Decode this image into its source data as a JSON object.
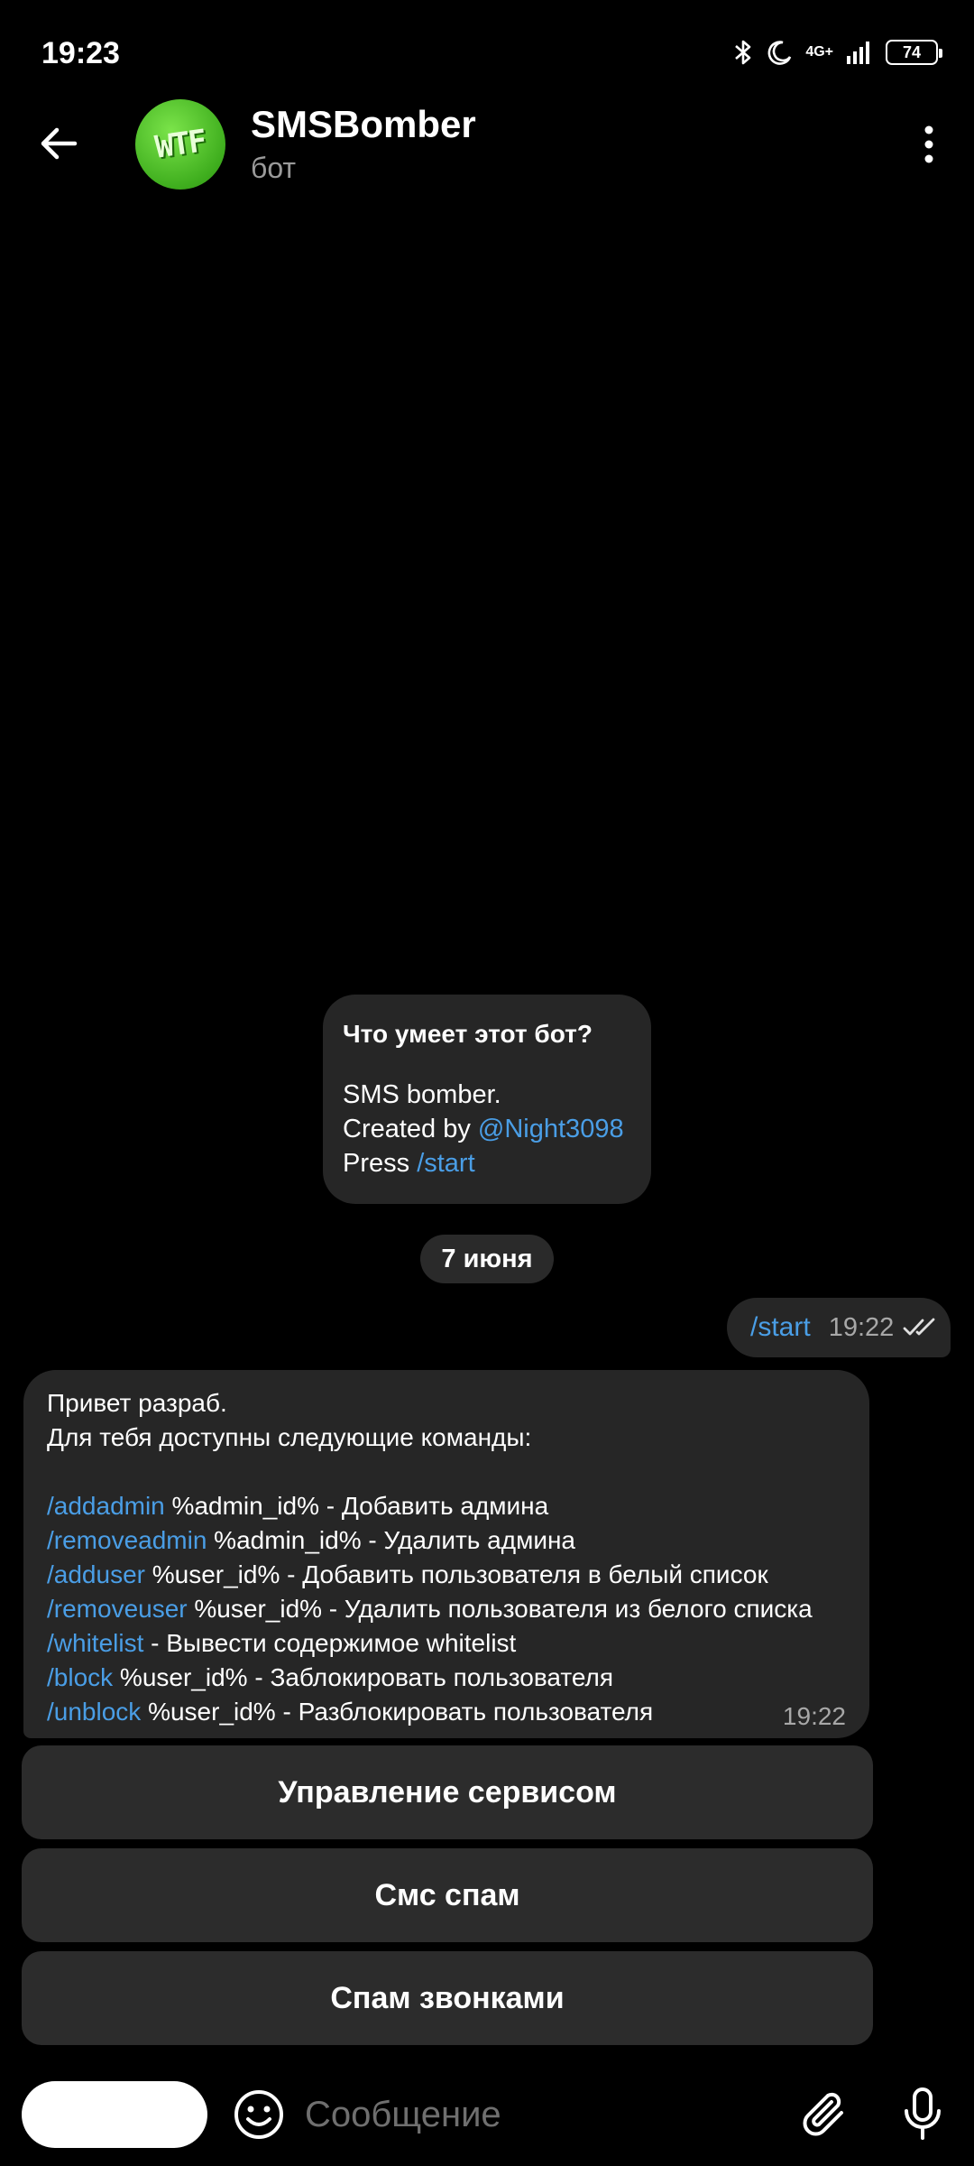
{
  "status_bar": {
    "time": "19:23",
    "network": "4G+",
    "battery": "74",
    "icons": [
      "bluetooth-icon",
      "moon-icon",
      "signal-icon",
      "battery-icon"
    ]
  },
  "header": {
    "title": "SMSBomber",
    "subtitle": "бот",
    "avatar_text": "WTF",
    "icons": [
      "arrow-left-icon",
      "more-vert-icon"
    ]
  },
  "bot_info": {
    "title": "Что умеет этот бот?",
    "line1": "SMS bomber.",
    "line2_prefix": "Created by ",
    "line2_link": "@Night3098",
    "line3_prefix": "Press ",
    "line3_link": "/start"
  },
  "date_chip": "7 июня",
  "outgoing": {
    "text": "/start",
    "time": "19:22"
  },
  "incoming": {
    "line1": "Привет разраб.",
    "line2": "Для тебя доступны следующие команды:",
    "commands": [
      {
        "cmd": "/addadmin",
        "desc": " %admin_id% - Добавить админа"
      },
      {
        "cmd": "/removeadmin",
        "desc": " %admin_id% - Удалить админа"
      },
      {
        "cmd": "/adduser",
        "desc": " %user_id% - Добавить пользователя в белый список"
      },
      {
        "cmd": "/removeuser",
        "desc": " %user_id% - Удалить пользователя из белого списка"
      },
      {
        "cmd": "/whitelist",
        "desc": " - Вывести содержимое whitelist"
      },
      {
        "cmd": "/block",
        "desc": " %user_id% - Заблокировать пользователя"
      },
      {
        "cmd": "/unblock",
        "desc": " %user_id% - Разблокировать пользователя"
      }
    ],
    "time": "19:22"
  },
  "keyboard": {
    "buttons": [
      "Управление сервисом",
      "Смс спам",
      "Спам звонками"
    ]
  },
  "input": {
    "placeholder": "Сообщение",
    "value": ""
  },
  "colors": {
    "background": "#000000",
    "bubble": "#262626",
    "link": "#4a9ee6",
    "avatar": "#3fae1e"
  }
}
